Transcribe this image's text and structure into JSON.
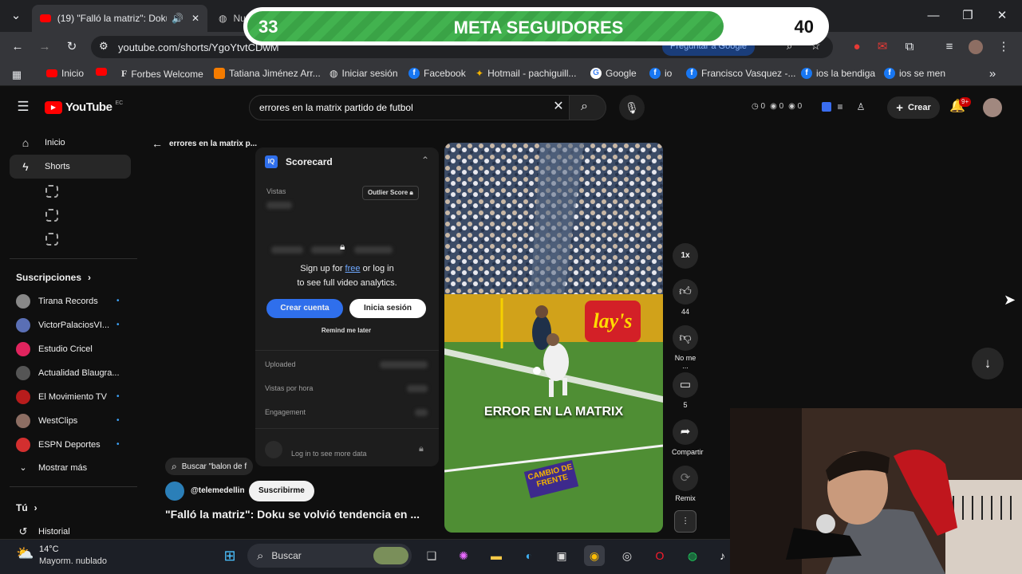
{
  "browser": {
    "active_tab_title": "(19) \"Falló la matriz\": Doku",
    "second_tab_title": "Nu",
    "url": "youtube.com/shorts/YgoYtvtCDwM",
    "google_button": "Preguntar a Google",
    "bookmarks": [
      {
        "label": "Inicio",
        "icon": "youtube-icon"
      },
      {
        "label": "",
        "icon": "youtube-icon"
      },
      {
        "label": "Forbes Welcome",
        "icon": "forbes-icon"
      },
      {
        "label": "Tatiana Jiménez Arr...",
        "icon": "page-icon"
      },
      {
        "label": "Iniciar sesión",
        "icon": "signin-icon"
      },
      {
        "label": "Facebook",
        "icon": "facebook-icon"
      },
      {
        "label": "Hotmail - pachiguill...",
        "icon": "hotmail-icon"
      },
      {
        "label": "Google",
        "icon": "google-icon"
      },
      {
        "label": "io",
        "icon": "facebook-icon"
      },
      {
        "label": "Francisco Vasquez -...",
        "icon": "facebook-icon"
      },
      {
        "label": "ios la bendiga",
        "icon": "facebook-icon"
      },
      {
        "label": "ios se men",
        "icon": "facebook-icon"
      }
    ]
  },
  "banner": {
    "current": "33",
    "title": "META SEGUIDORES",
    "goal": "40",
    "progress_fraction": 0.825,
    "fill_color": "#42b24f"
  },
  "youtube": {
    "logo": "YouTube",
    "country": "EC",
    "search_value": "errores en la matrix partido de futbol",
    "stats": [
      "0",
      "0",
      "0"
    ],
    "create_label": "Crear",
    "notif_count": "9+",
    "back_title": "errores en la matrix p..."
  },
  "sidebar": {
    "items": [
      {
        "label": "Inicio",
        "icon": "home-icon"
      },
      {
        "label": "Shorts",
        "icon": "shorts-icon"
      }
    ],
    "subs_title": "Suscripciones",
    "subscriptions": [
      {
        "label": "Tirana Records",
        "color": "#888888"
      },
      {
        "label": "VictorPalaciosVI...",
        "color": "#5a6fb5"
      },
      {
        "label": "Estudio Cricel",
        "color": "#e0245e"
      },
      {
        "label": "Actualidad Blaugra...",
        "color": "#555555"
      },
      {
        "label": "El Movimiento TV",
        "color": "#b71c1c"
      },
      {
        "label": "WestClips",
        "color": "#8d6e63"
      },
      {
        "label": "ESPN Deportes",
        "color": "#d32f2f"
      }
    ],
    "show_more": "Mostrar más",
    "you": "Tú",
    "history": "Historial"
  },
  "scorecard": {
    "title": "Scorecard",
    "views_label": "Vistas",
    "outlier_label": "Outlier Score",
    "signup_line1_a": "Sign up for ",
    "signup_free": "free",
    "signup_line1_b": " or log in",
    "signup_line2": "to see full video analytics.",
    "create_account": "Crear cuenta",
    "login": "Inicia sesión",
    "remind": "Remind me later",
    "uploaded": "Uploaded",
    "views_per_hour": "Vistas por hora",
    "engagement": "Engagement",
    "login_more": "Log in to see more data"
  },
  "video": {
    "overlay_text": "ERROR EN LA MATRIX",
    "badge": "CAMBIO DE FRENTE",
    "search_chip": "Buscar \"balon de f",
    "channel": "@telemedellin",
    "subscribe": "Suscribirme",
    "title": "\"Falló la matriz\": Doku se volvió tendencia en ...",
    "speed": "1x",
    "likes": "44",
    "dislike_label": "No me ...",
    "comments": "5",
    "share": "Compartir",
    "remix": "Remix"
  },
  "taskbar": {
    "temp": "14°C",
    "weather": "Mayorm. nublado",
    "search_placeholder": "Buscar"
  }
}
